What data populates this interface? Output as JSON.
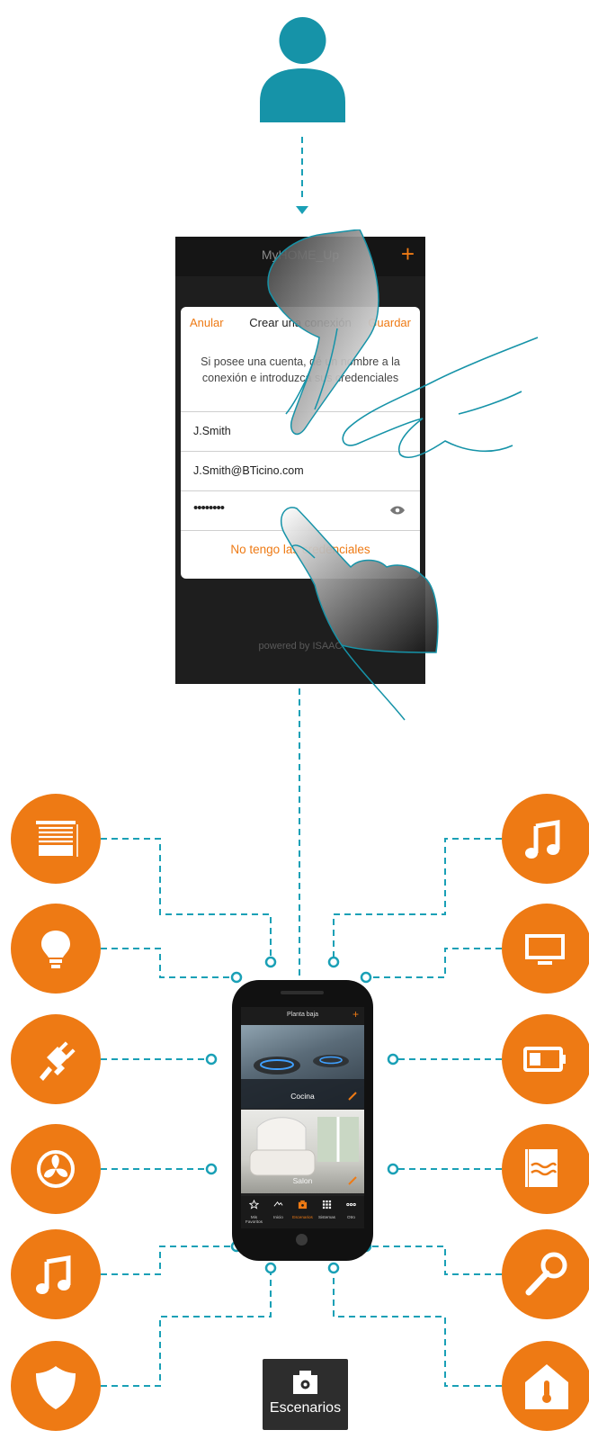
{
  "colors": {
    "accent_orange": "#ee7a14",
    "connector_teal": "#1aa0b6",
    "avatar_teal": "#1693a8"
  },
  "login_screen": {
    "app_title": "MyHOME_Up",
    "dialog": {
      "cancel_label": "Anular",
      "title": "Crear una conexión",
      "save_label": "Guardar",
      "message": "Si posee una cuenta, dé un nombre a la conexión e introduzca sus credenciales",
      "name_value": "J.Smith",
      "email_value": "J.Smith@BTicino.com",
      "password_value": "••••••••",
      "no_credentials_link": "No tengo las credenciales"
    },
    "powered_by": "powered by ISAAC"
  },
  "phone": {
    "floor_label": "Planta baja",
    "add_icon": "+",
    "scenes": [
      {
        "label": "Cocina"
      },
      {
        "label": "Salon"
      }
    ],
    "tabs": [
      {
        "label": "Mis Favoritos",
        "icon": "star-icon"
      },
      {
        "label": "Inicio",
        "icon": "home-roof-icon"
      },
      {
        "label": "Escenarios",
        "icon": "scenarios-icon"
      },
      {
        "label": "Sistemas",
        "icon": "grid-icon"
      },
      {
        "label": "Otro",
        "icon": "more-icon"
      }
    ]
  },
  "left_devices": [
    "blinds-icon",
    "lightbulb-icon",
    "power-plug-icon",
    "fan-icon",
    "music-icon",
    "shield-icon"
  ],
  "right_devices": [
    "music-icon",
    "tv-icon",
    "battery-icon",
    "water-heater-icon",
    "door-key-icon",
    "home-temperature-icon"
  ],
  "badge": {
    "label": "Escenarios",
    "icon": "scenarios-icon"
  }
}
